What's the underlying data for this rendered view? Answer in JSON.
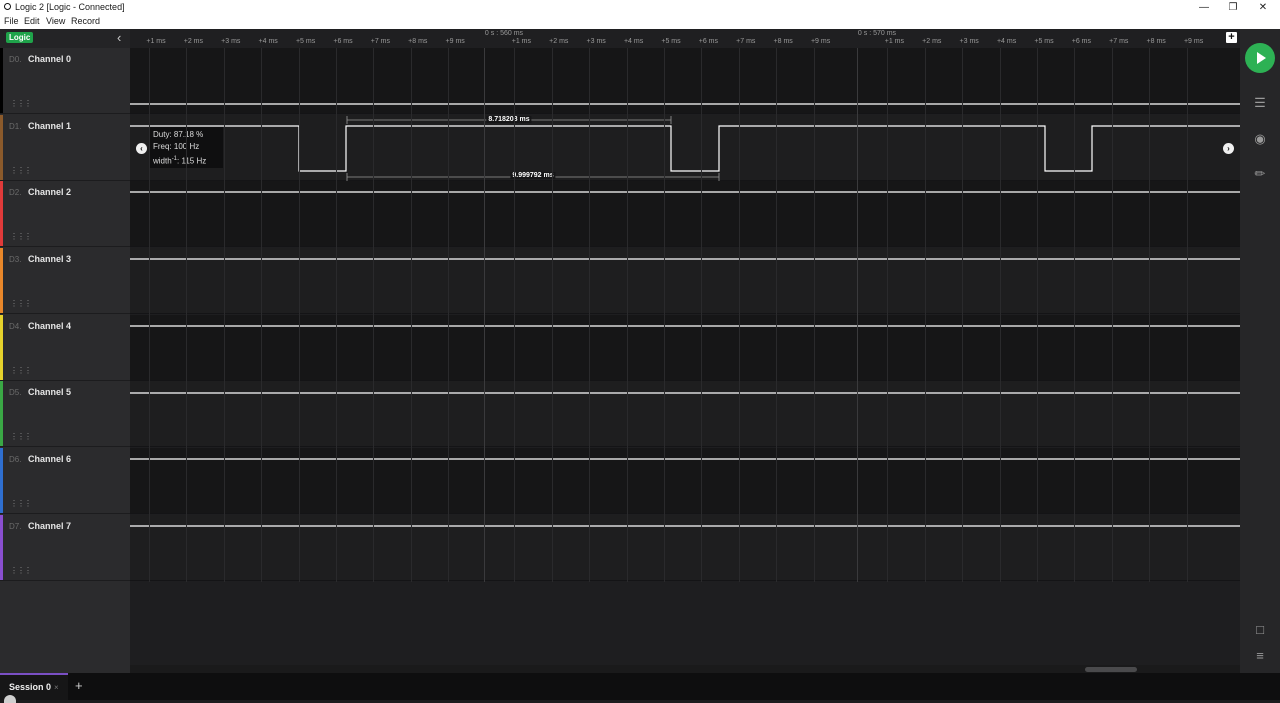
{
  "window": {
    "title": "Logic 2 [Logic - Connected]",
    "controls": [
      "—",
      "❐",
      "✕"
    ]
  },
  "menu": [
    "File",
    "Edit",
    "View",
    "Record"
  ],
  "sidebar": {
    "badge": "Logic",
    "channels": [
      {
        "id": "D0.",
        "name": "Channel 0",
        "color": "#000000"
      },
      {
        "id": "D1.",
        "name": "Channel 1",
        "color": "#8b5a2b"
      },
      {
        "id": "D2.",
        "name": "Channel 2",
        "color": "#e03a3a"
      },
      {
        "id": "D3.",
        "name": "Channel 3",
        "color": "#e8872a"
      },
      {
        "id": "D4.",
        "name": "Channel 4",
        "color": "#e6d22c"
      },
      {
        "id": "D5.",
        "name": "Channel 5",
        "color": "#3aa845"
      },
      {
        "id": "D6.",
        "name": "Channel 6",
        "color": "#2f6fd0"
      },
      {
        "id": "D7.",
        "name": "Channel 7",
        "color": "#8a4fd0"
      }
    ]
  },
  "ruler": {
    "major_labels": [
      "0 s : 560 ms",
      "0 s : 570 ms"
    ],
    "ticks": [
      "+1 ms",
      "+2 ms",
      "+3 ms",
      "+4 ms",
      "+5 ms",
      "+6 ms",
      "+7 ms",
      "+8 ms",
      "+9 ms",
      "+1 ms",
      "+2 ms",
      "+3 ms",
      "+4 ms",
      "+5 ms",
      "+6 ms",
      "+7 ms",
      "+8 ms",
      "+9 ms",
      "+1 ms",
      "+2 ms",
      "+3 ms",
      "+4 ms",
      "+5 ms",
      "+6 ms",
      "+7 ms",
      "+8 ms",
      "+9 ms"
    ]
  },
  "measurement": {
    "duty": "Duty: 87.18 %",
    "freq": "Freq: 100 Hz",
    "width_label": "width",
    "width_sup": "-1",
    "width_value": ": 115 Hz",
    "high_width": "8.718208 ms",
    "period": "9.999792 ms"
  },
  "session": {
    "tab_label": "Session 0",
    "close": "×",
    "add": "+"
  },
  "icons": {
    "collapse": "chevron-left-icon",
    "play": "play-icon",
    "settings": "sliders-icon",
    "analyzers": "waveform-icon",
    "measure": "ruler-icon",
    "notes": "comment-icon",
    "menu": "hamburger-icon",
    "grip": "drag-handle-icon"
  },
  "colors": {
    "accent_green": "#2db154",
    "badge_green": "#1fa34a",
    "signal": "#ffffff",
    "session_accent": "#7a4fc4"
  }
}
